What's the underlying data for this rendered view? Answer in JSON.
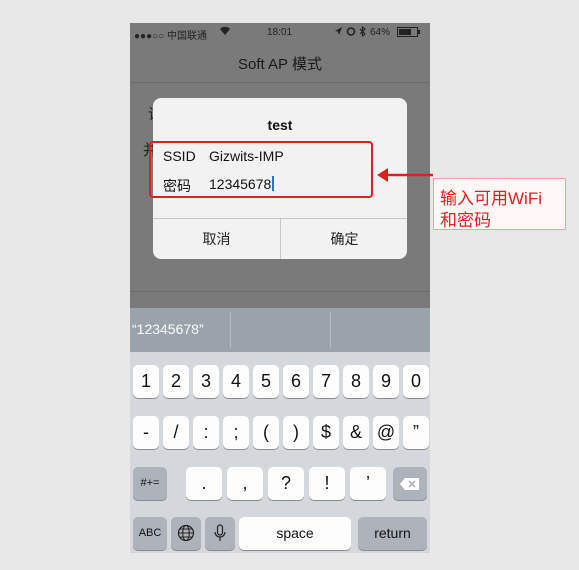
{
  "status_bar": {
    "carrier": "●●●○○ 中国联通",
    "time": "18:01",
    "battery": "64%"
  },
  "nav": {
    "title": "Soft AP 模式"
  },
  "background": {
    "partial_text_1": "请",
    "partial_text_2": "并"
  },
  "dialog": {
    "title": "test",
    "ssid_label": "SSID",
    "ssid_value": "Gizwits-IMP",
    "password_label": "密码",
    "password_value": "12345678",
    "cancel_label": "取消",
    "confirm_label": "确定"
  },
  "annotation": {
    "line1": "输入可用WiFi",
    "line2": "和密码"
  },
  "keyboard": {
    "suggestion": "“12345678”",
    "row1": [
      "1",
      "2",
      "3",
      "4",
      "5",
      "6",
      "7",
      "8",
      "9",
      "0"
    ],
    "row2": [
      "-",
      "/",
      ":",
      ";",
      "(",
      ")",
      "$",
      "&",
      "@",
      "”"
    ],
    "row3_left": "#+=",
    "row3": [
      ".",
      ",",
      "?",
      "!",
      "’"
    ],
    "abc": "ABC",
    "space": "space",
    "return": "return"
  },
  "colors": {
    "annotation_red": "#e02020",
    "caret_blue": "#2a6fd6"
  }
}
